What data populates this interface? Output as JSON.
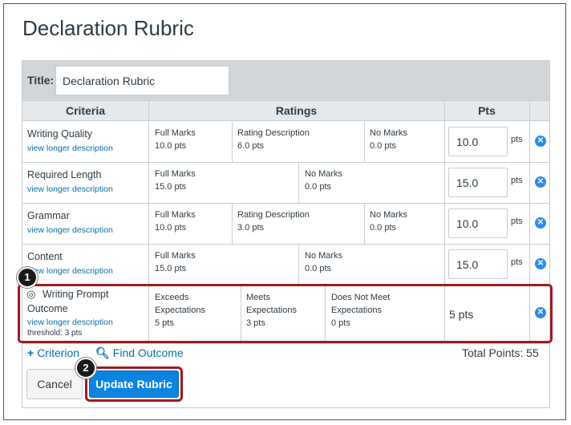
{
  "page_title": "Declaration Rubric",
  "rubric": {
    "title_label": "Title:",
    "title_value": "Declaration Rubric",
    "headers": {
      "criteria": "Criteria",
      "ratings": "Ratings",
      "pts": "Pts"
    },
    "pts_suffix": "pts",
    "criteria": [
      {
        "name": "Writing Quality",
        "link": "view longer description",
        "ratings": [
          {
            "title": "Full Marks",
            "pts": "10.0 pts"
          },
          {
            "title": "Rating Description",
            "pts": "6.0 pts"
          },
          {
            "title": "No Marks",
            "pts": "0.0 pts"
          }
        ],
        "points": "10.0"
      },
      {
        "name": "Required Length",
        "link": "view longer description",
        "ratings": [
          {
            "title": "Full Marks",
            "pts": "15.0 pts"
          },
          {
            "title": "No Marks",
            "pts": "0.0 pts"
          }
        ],
        "points": "15.0"
      },
      {
        "name": "Grammar",
        "link": "view longer description",
        "ratings": [
          {
            "title": "Full Marks",
            "pts": "10.0 pts"
          },
          {
            "title": "Rating Description",
            "pts": "3.0 pts"
          },
          {
            "title": "No Marks",
            "pts": "0.0 pts"
          }
        ],
        "points": "10.0"
      },
      {
        "name": "Content",
        "link": "view longer description",
        "ratings": [
          {
            "title": "Full Marks",
            "pts": "15.0 pts"
          },
          {
            "title": "No Marks",
            "pts": "0.0 pts"
          }
        ],
        "points": "15.0"
      }
    ],
    "outcome": {
      "name_line1": "Writing Prompt",
      "name_line2": "Outcome",
      "link": "view longer description",
      "threshold": "threshold: 3 pts",
      "ratings": [
        {
          "line1": "Exceeds",
          "line2": "Expectations",
          "pts": "5 pts"
        },
        {
          "line1": "Meets",
          "line2": "Expectations",
          "pts": "3 pts"
        },
        {
          "line1": "Does Not Meet",
          "line2": "Expectations",
          "pts": "0 pts"
        }
      ],
      "points": "5 pts"
    }
  },
  "footer": {
    "add_criterion": "Criterion",
    "find_outcome": "Find Outcome",
    "total_points": "Total Points: 55"
  },
  "buttons": {
    "cancel": "Cancel",
    "update": "Update Rubric"
  },
  "steps": [
    "1",
    "2"
  ],
  "icons": {
    "add": "plus-icon",
    "search": "magnifier-icon",
    "delete": "close-circle-icon",
    "outcome": "target-icon"
  },
  "colors": {
    "link": "#0770a3",
    "primary": "#0b84e0",
    "highlight": "#9e1b23",
    "header_bg": "#d1d5d8"
  }
}
